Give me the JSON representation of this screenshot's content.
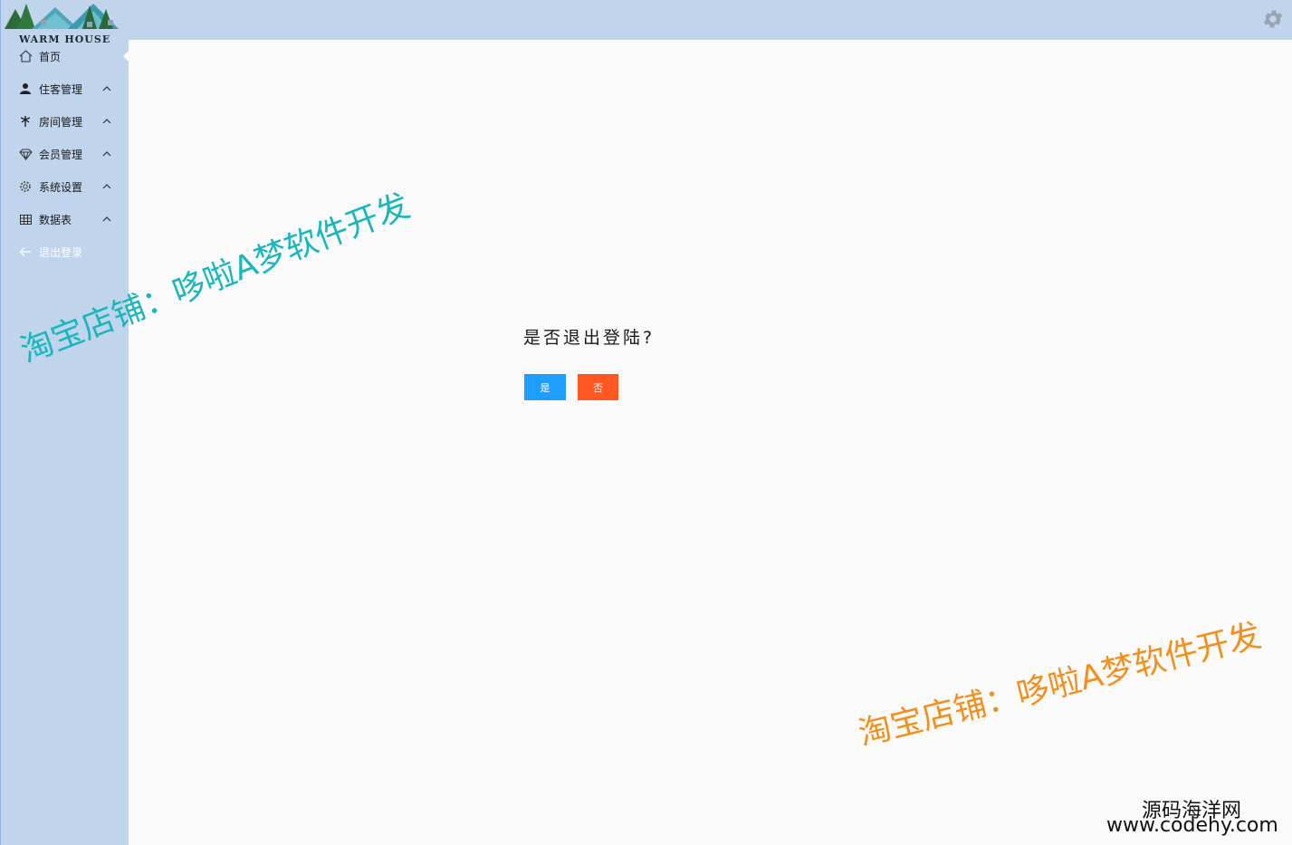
{
  "header": {
    "settings_icon": "gear-icon"
  },
  "logo": {
    "text": "WARM HOUSE"
  },
  "sidebar": {
    "items": [
      {
        "label": "首页",
        "icon": "home-icon",
        "active": true
      },
      {
        "label": "住客管理",
        "icon": "user-icon",
        "expandable": true
      },
      {
        "label": "房间管理",
        "icon": "palm-tree-icon",
        "expandable": true
      },
      {
        "label": "会员管理",
        "icon": "diamond-icon",
        "expandable": true
      },
      {
        "label": "系统设置",
        "icon": "cog-icon",
        "expandable": true
      },
      {
        "label": "数据表",
        "icon": "table-icon",
        "expandable": true
      },
      {
        "label": "退出登录",
        "icon": "arrow-left-icon"
      }
    ]
  },
  "dialog": {
    "title": "是否退出登陆?",
    "yes_label": "是",
    "no_label": "否"
  },
  "colors": {
    "sidebar_bg": "#c0d4ec",
    "yes_button": "#1e9fff",
    "no_button": "#ff5722",
    "watermark_teal": "#19b7bd",
    "watermark_orange": "#f0901f"
  },
  "watermarks": {
    "left": "淘宝店铺：哆啦A梦软件开发",
    "right": "淘宝店铺：哆啦A梦软件开发",
    "corner_line1": "源码海洋网",
    "corner_line2": "www.codehy.com"
  }
}
